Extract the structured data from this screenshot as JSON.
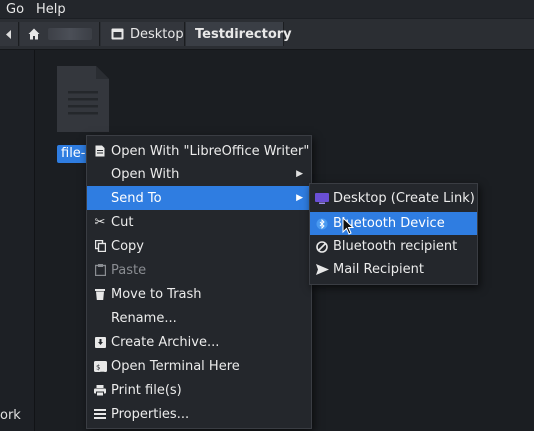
{
  "menubar": {
    "go": "Go",
    "help": "Help"
  },
  "breadcrumb": {
    "desktop": "Desktop",
    "current": "Testdirectory"
  },
  "sidebar": {
    "partial_text": "ork"
  },
  "file": {
    "label": "file-1"
  },
  "context_menu": {
    "items": [
      {
        "label": "Open With \"LibreOffice Writer\"",
        "icon": "document-icon"
      },
      {
        "label": "Open With",
        "icon": "",
        "submenu": true
      },
      {
        "label": "Send To",
        "icon": "",
        "submenu": true,
        "highlighted": true
      },
      {
        "label": "Cut",
        "icon": "scissors-icon"
      },
      {
        "label": "Copy",
        "icon": "copy-icon"
      },
      {
        "label": "Paste",
        "icon": "paste-icon",
        "disabled": true
      },
      {
        "label": "Move to Trash",
        "icon": "trash-icon"
      },
      {
        "label": "Rename...",
        "icon": ""
      },
      {
        "label": "Create Archive...",
        "icon": "archive-icon"
      },
      {
        "label": "Open Terminal Here",
        "icon": "terminal-icon"
      },
      {
        "label": "Print file(s)",
        "icon": "printer-icon"
      },
      {
        "label": "Properties...",
        "icon": "properties-icon"
      }
    ]
  },
  "send_to_submenu": {
    "items": [
      {
        "label": "Desktop (Create Link)",
        "icon": "desktop-icon"
      },
      {
        "label": "Bluetooth Device",
        "icon": "bluetooth-icon",
        "highlighted": true
      },
      {
        "label": "Bluetooth recipient",
        "icon": "block-icon"
      },
      {
        "label": "Mail Recipient",
        "icon": "send-icon"
      }
    ]
  },
  "colors": {
    "highlight": "#2f7de1",
    "background": "#1b1e22",
    "menu": "#24272c"
  }
}
